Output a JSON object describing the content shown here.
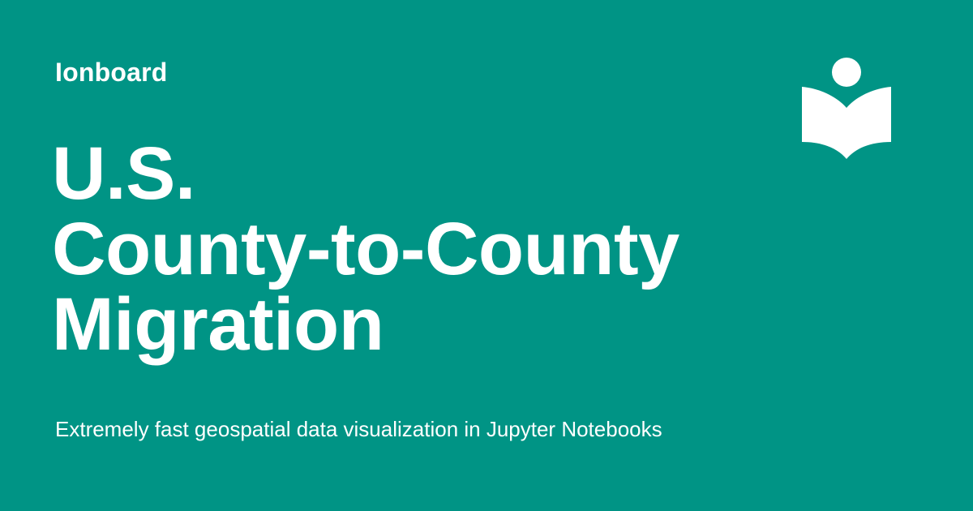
{
  "site": {
    "name": "Ionboard"
  },
  "page": {
    "title_lines": [
      "U.S.",
      "County-to-County",
      "Migration"
    ],
    "subtitle": "Extremely fast geospatial data visualization in Jupyter Notebooks"
  },
  "logo": {
    "icon": "reader-book-icon"
  },
  "colors": {
    "background": "#009485",
    "text": "#ffffff"
  }
}
